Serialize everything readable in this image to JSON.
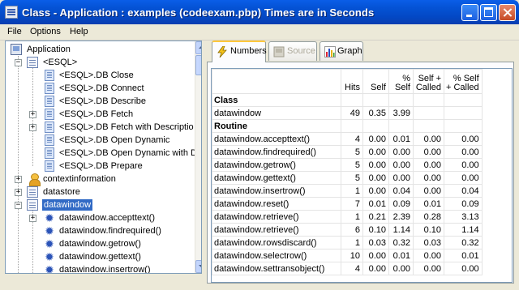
{
  "window": {
    "title": "Class - Application : examples (codeexam.pbp) Times are in Seconds"
  },
  "menu": {
    "items": [
      "File",
      "Options",
      "Help"
    ]
  },
  "tree": {
    "root": "Application",
    "esql": "<ESQL>",
    "esql_items": [
      "<ESQL>.DB Close",
      "<ESQL>.DB Connect",
      "<ESQL>.DB Describe",
      "<ESQL>.DB Fetch",
      "<ESQL>.DB Fetch with Descriptio",
      "<ESQL>.DB Open Dynamic",
      "<ESQL>.DB Open Dynamic with D",
      "<ESQL>.DB Prepare"
    ],
    "contextinformation": "contextinformation",
    "datastore": "datastore",
    "datawindow": "datawindow",
    "datawindow_items": [
      "datawindow.accepttext()",
      "datawindow.findrequired()",
      "datawindow.getrow()",
      "datawindow.gettext()",
      "datawindow.insertrow()"
    ]
  },
  "tabs": {
    "numbers": "Numbers",
    "source": "Source",
    "graph": "Graph"
  },
  "table": {
    "headers": {
      "hits": "Hits",
      "self": "Self",
      "pct_self_1": "%",
      "pct_self_2": "Self",
      "self_called_1": "Self +",
      "self_called_2": "Called",
      "pct_called_1": "% Self",
      "pct_called_2": "+ Called"
    },
    "class_label": "Class",
    "class_row": {
      "name": "datawindow",
      "hits": "49",
      "self": "0.35",
      "pct_self": "3.99"
    },
    "routine_label": "Routine",
    "routines": [
      {
        "name": "datawindow.accepttext()",
        "hits": "4",
        "self": "0.00",
        "pct_self": "0.01",
        "self_called": "0.00",
        "pct_called": "0.00"
      },
      {
        "name": "datawindow.findrequired()",
        "hits": "5",
        "self": "0.00",
        "pct_self": "0.00",
        "self_called": "0.00",
        "pct_called": "0.00"
      },
      {
        "name": "datawindow.getrow()",
        "hits": "5",
        "self": "0.00",
        "pct_self": "0.00",
        "self_called": "0.00",
        "pct_called": "0.00"
      },
      {
        "name": "datawindow.gettext()",
        "hits": "5",
        "self": "0.00",
        "pct_self": "0.00",
        "self_called": "0.00",
        "pct_called": "0.00"
      },
      {
        "name": "datawindow.insertrow()",
        "hits": "1",
        "self": "0.00",
        "pct_self": "0.04",
        "self_called": "0.00",
        "pct_called": "0.04"
      },
      {
        "name": "datawindow.reset()",
        "hits": "7",
        "self": "0.01",
        "pct_self": "0.09",
        "self_called": "0.01",
        "pct_called": "0.09"
      },
      {
        "name": "datawindow.retrieve()",
        "hits": "1",
        "self": "0.21",
        "pct_self": "2.39",
        "self_called": "0.28",
        "pct_called": "3.13"
      },
      {
        "name": "datawindow.retrieve()",
        "hits": "6",
        "self": "0.10",
        "pct_self": "1.14",
        "self_called": "0.10",
        "pct_called": "1.14"
      },
      {
        "name": "datawindow.rowsdiscard()",
        "hits": "1",
        "self": "0.03",
        "pct_self": "0.32",
        "self_called": "0.03",
        "pct_called": "0.32"
      },
      {
        "name": "datawindow.selectrow()",
        "hits": "10",
        "self": "0.00",
        "pct_self": "0.01",
        "self_called": "0.00",
        "pct_called": "0.01"
      },
      {
        "name": "datawindow.settransobject()",
        "hits": "4",
        "self": "0.00",
        "pct_self": "0.00",
        "self_called": "0.00",
        "pct_called": "0.00"
      }
    ]
  }
}
